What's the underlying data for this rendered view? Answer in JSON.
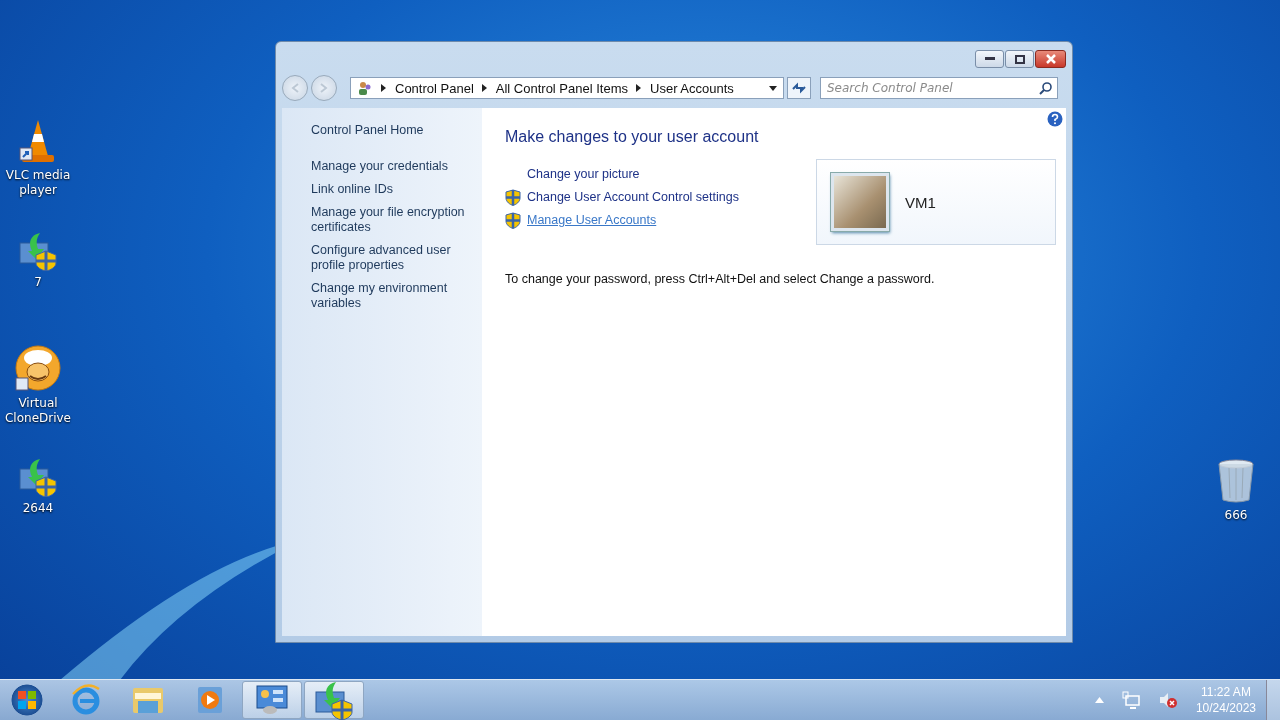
{
  "desktop_icons": [
    {
      "kind": "vlc",
      "label": "VLC media player"
    },
    {
      "kind": "installer",
      "label": "7"
    },
    {
      "kind": "clonedrive",
      "label": "Virtual CloneDrive"
    },
    {
      "kind": "installer",
      "label": "2644"
    }
  ],
  "desktop_icons_right": [
    {
      "kind": "recycle",
      "label": "666"
    }
  ],
  "window": {
    "breadcrumb": [
      "Control Panel",
      "All Control Panel Items",
      "User Accounts"
    ],
    "search": {
      "placeholder": "Search Control Panel"
    },
    "sidebar": {
      "items": [
        {
          "label": "Control Panel Home",
          "kind": "home"
        },
        {
          "label": "Manage your credentials",
          "kind": "link"
        },
        {
          "label": "Link online IDs",
          "kind": "link"
        },
        {
          "label": "Manage your file encryption certificates",
          "kind": "link"
        },
        {
          "label": "Configure advanced user profile properties",
          "kind": "link"
        },
        {
          "label": "Change my environment variables",
          "kind": "link"
        }
      ]
    },
    "heading": "Make changes to your user account",
    "tasks": [
      {
        "label": "Change your picture",
        "kind": "plain",
        "hovered": false
      },
      {
        "label": "Change User Account Control settings",
        "kind": "shield",
        "hovered": false
      },
      {
        "label": "Manage User Accounts",
        "kind": "shield",
        "hovered": true
      }
    ],
    "account": {
      "name": "VM1"
    },
    "note": "To change your password, press Ctrl+Alt+Del and select Change a password."
  },
  "taskbar": {
    "items": [
      {
        "kind": "ie",
        "active": false
      },
      {
        "kind": "explorer",
        "active": false
      },
      {
        "kind": "media",
        "active": false
      },
      {
        "kind": "controlpanel",
        "active": true
      },
      {
        "kind": "installer",
        "active": true
      }
    ],
    "time": "11:22 AM",
    "date": "10/24/2023"
  }
}
